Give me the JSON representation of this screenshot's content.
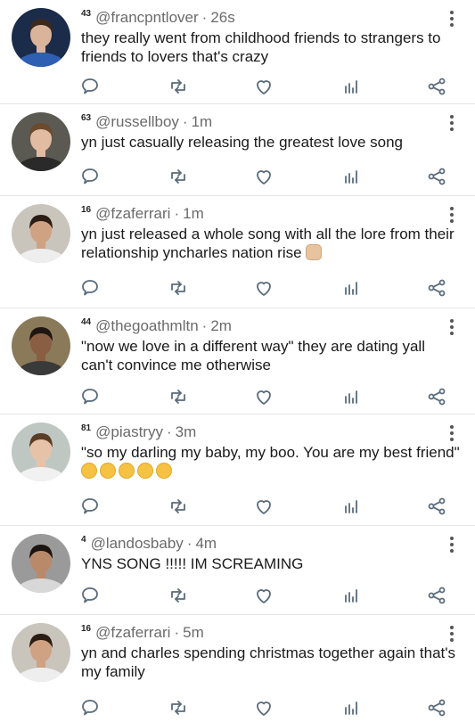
{
  "posts": [
    {
      "level": "43",
      "handle": "@francpntlover",
      "time": "26s",
      "text": "they really went from childhood friends to strangers to friends to lovers that's crazy",
      "emoji": [],
      "avatar": {
        "bg": "#1b2b4a",
        "skin": "#d9b49a",
        "hair": "#3a2a1e",
        "shirt": "#2f5fb3"
      }
    },
    {
      "level": "63",
      "handle": "@russellboy",
      "time": "1m",
      "text": "yn just casually releasing the greatest love song",
      "emoji": [],
      "avatar": {
        "bg": "#5a5a52",
        "skin": "#e2bca2",
        "hair": "#6b4a2e",
        "shirt": "#2a2a2a"
      }
    },
    {
      "level": "16",
      "handle": "@fzaferrari",
      "time": "1m",
      "text": "yn just released a whole song with all the lore from their relationship yncharles nation rise",
      "emoji": [
        "fist"
      ],
      "avatar": {
        "bg": "#c9c4bc",
        "skin": "#cfa283",
        "hair": "#2b1d14",
        "shirt": "#eeeeee"
      }
    },
    {
      "level": "44",
      "handle": "@thegoathmltn",
      "time": "2m",
      "text": "\"now we love in a different way\" they are dating yall can't convince me otherwise",
      "emoji": [],
      "avatar": {
        "bg": "#8a7a5a",
        "skin": "#8a5e43",
        "hair": "#1f1612",
        "shirt": "#3a3a3a"
      }
    },
    {
      "level": "81",
      "handle": "@piastryy",
      "time": "3m",
      "text": "\"so my darling my baby, my boo. You are my best friend\"",
      "emoji": [
        "pleading",
        "pleading",
        "pleading",
        "pleading",
        "pleading"
      ],
      "avatar": {
        "bg": "#bfc7c2",
        "skin": "#e6c3a8",
        "hair": "#5a3d25",
        "shirt": "#f1f1f1"
      }
    },
    {
      "level": "4",
      "handle": "@landosbaby",
      "time": "4m",
      "text": "YNS SONG !!!!! IM SCREAMING",
      "emoji": [],
      "avatar": {
        "bg": "#9a9a9a",
        "skin": "#b98a6a",
        "hair": "#1c1410",
        "shirt": "#d8d8d8"
      }
    },
    {
      "level": "16",
      "handle": "@fzaferrari",
      "time": "5m",
      "text": "yn and charles spending christmas together again that's my family",
      "emoji": [],
      "avatar": {
        "bg": "#c9c4bc",
        "skin": "#cfa283",
        "hair": "#2b1d14",
        "shirt": "#eeeeee"
      }
    }
  ],
  "actions": [
    "reply-icon",
    "repost-icon",
    "like-icon",
    "stats-icon",
    "share-icon"
  ],
  "colors": {
    "icon": "#5a6b7a",
    "divider": "#e4e4e4",
    "text": "#1a1a1a",
    "meta": "#6b6b6b"
  }
}
